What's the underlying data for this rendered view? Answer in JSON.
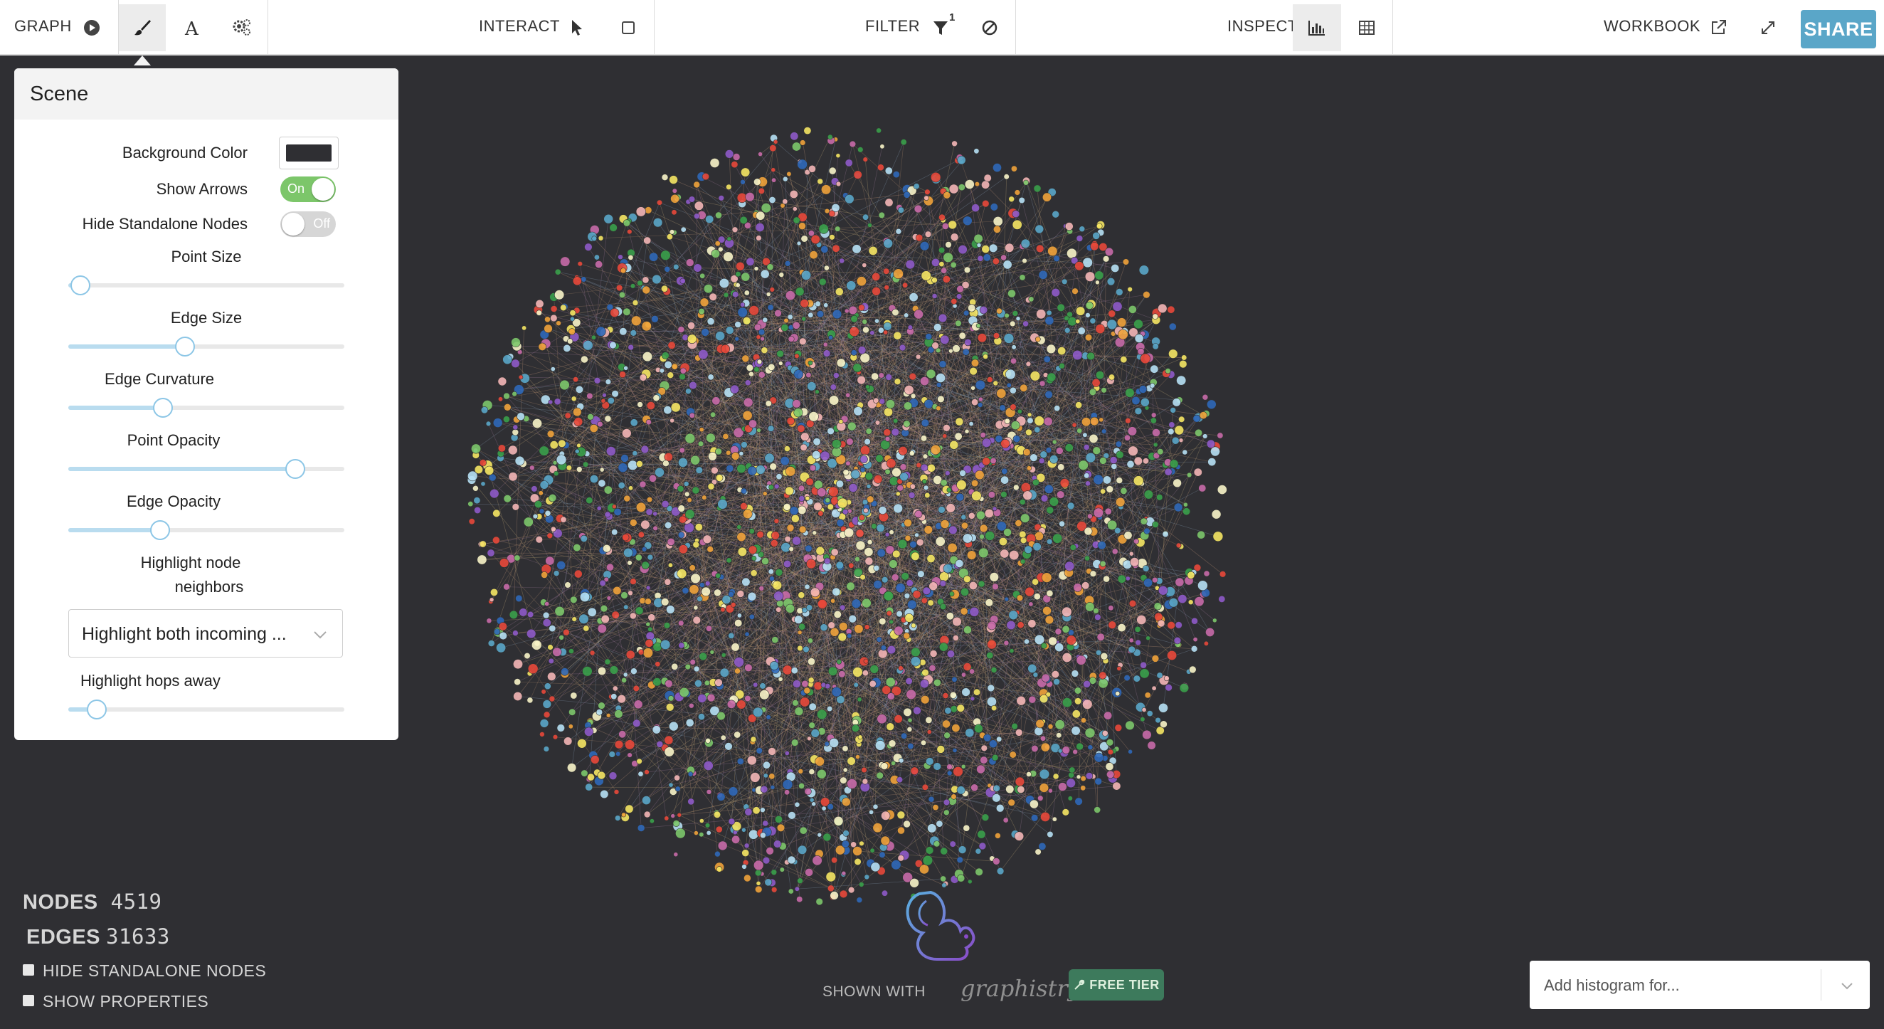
{
  "toolbar": {
    "graph_label": "GRAPH",
    "interact_label": "INTERACT",
    "filter_label": "FILTER",
    "filter_badge": "1",
    "inspect_label": "INSPECT",
    "workbook_label": "WORKBOOK",
    "share_label": "SHARE"
  },
  "scene": {
    "title": "Scene",
    "background_color_label": "Background Color",
    "background_color": "#2f2f33",
    "show_arrows_label": "Show Arrows",
    "show_arrows_state": "On",
    "hide_standalone_label": "Hide Standalone Nodes",
    "hide_standalone_state": "Off",
    "point_size_label": "Point Size",
    "point_size_value": 0.04,
    "edge_size_label": "Edge Size",
    "edge_size_value": 0.42,
    "edge_curvature_label": "Edge Curvature",
    "edge_curvature_value": 0.34,
    "point_opacity_label": "Point Opacity",
    "point_opacity_value": 0.82,
    "edge_opacity_label": "Edge Opacity",
    "edge_opacity_value": 0.33,
    "highlight_neighbors_label_1": "Highlight node",
    "highlight_neighbors_label_2": "neighbors",
    "highlight_neighbors_value": "Highlight both incoming ...",
    "highlight_hops_label": "Highlight hops away",
    "highlight_hops_value": 0.1
  },
  "stats": {
    "nodes_label": "NODES",
    "nodes_value": "4519",
    "edges_label": "EDGES",
    "edges_value": "31633",
    "hide_standalone_checkbox": "HIDE STANDALONE NODES",
    "show_properties_checkbox": "SHOW PROPERTIES"
  },
  "histogram": {
    "placeholder": "Add histogram for..."
  },
  "branding": {
    "shown_with": "SHOWN WITH",
    "brand_name": "graphistry",
    "free_tier": "FREE TIER"
  },
  "colors": {
    "accent": "#5aa6c8",
    "toggle_on": "#7cc66a",
    "free_tier": "#3d7a5c",
    "node_palette": [
      "#e8483a",
      "#f0a23a",
      "#f5e663",
      "#7cc66a",
      "#3aa04a",
      "#5aa6c8",
      "#2f68b8",
      "#8e5ac8",
      "#c86aa8",
      "#f4b6b6",
      "#b6e0f4",
      "#f8f4c8"
    ]
  }
}
